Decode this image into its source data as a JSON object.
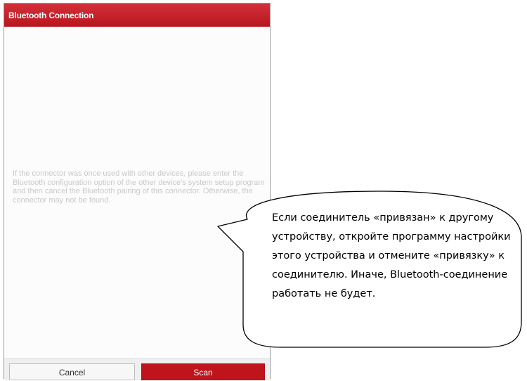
{
  "dialog": {
    "title": "Bluetooth Connection",
    "message": "If the connector was once used with other devices, please enter the Bluetooth configuration option of the other device's system setup program and then cancel the Bluetooth pairing of this connector. Otherwise, the connector may not be found.",
    "buttons": {
      "cancel": "Cancel",
      "scan": "Scan"
    }
  },
  "callout": {
    "text": "Если соединитель «привязан» к другому устройству, откройте программу настройки этого устройства и отмените «привязку» к соединителю. Иначе, Bluetooth-соединение работать не будет."
  },
  "colors": {
    "accent": "#c0141d",
    "title_bar": "#c8222b",
    "message_text": "#c9c9c9"
  }
}
